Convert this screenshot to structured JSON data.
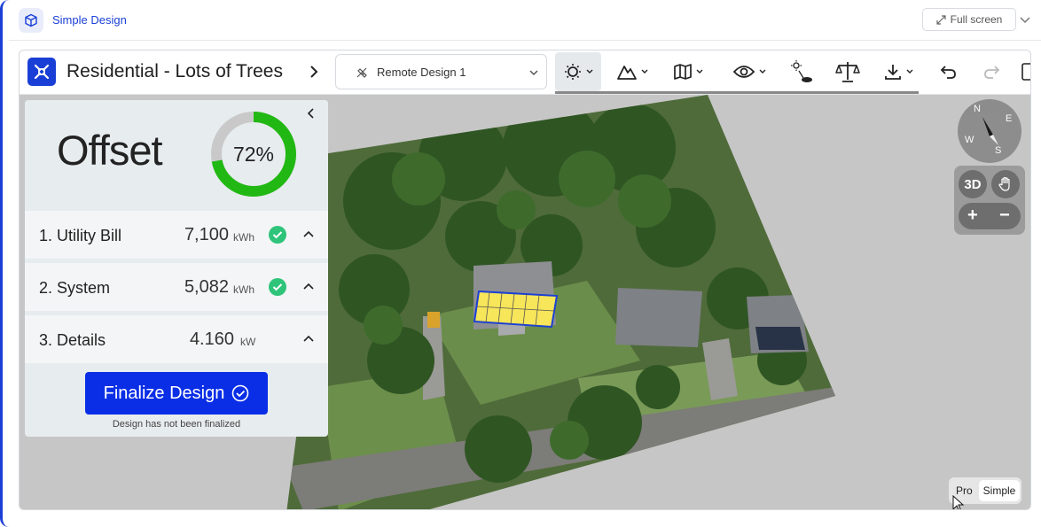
{
  "header": {
    "app_title": "Simple Design",
    "fullscreen_label": "Full screen"
  },
  "toolbar": {
    "project_title": "Residential - Lots of Trees",
    "design_select_value": "Remote Design 1",
    "tools": [
      "sun-shade-icon",
      "terrain-icon",
      "map-icon",
      "eye-icon",
      "tree-shade-icon",
      "scale-icon",
      "download-icon",
      "undo-icon",
      "redo-icon"
    ]
  },
  "panel": {
    "offset_title": "Offset",
    "offset_percent": "72%",
    "offset_fraction": 0.72,
    "rows": [
      {
        "name": "1. Utility Bill",
        "value": "7,100",
        "unit": "kWh",
        "checked": true
      },
      {
        "name": "2. System",
        "value": "5,082",
        "unit": "kWh",
        "checked": true
      },
      {
        "name": "3. Details",
        "value": "4.160",
        "unit": "kW",
        "checked": false
      }
    ],
    "finalize_label": "Finalize Design",
    "finalize_note": "Design has not been finalized"
  },
  "map_controls": {
    "compass": {
      "n": "N",
      "e": "E",
      "s": "S",
      "w": "W"
    },
    "btn_3d": "3D",
    "zoom_in": "+",
    "zoom_out": "−"
  },
  "mode_toggle": {
    "pro": "Pro",
    "simple": "Simple",
    "active": "Simple"
  },
  "colors": {
    "brand_blue": "#1a3fd6",
    "button_blue": "#0a2ee6",
    "donut_green": "#22b814",
    "check_green": "#2ec47a",
    "panel_yellow": "#f7e55a"
  }
}
